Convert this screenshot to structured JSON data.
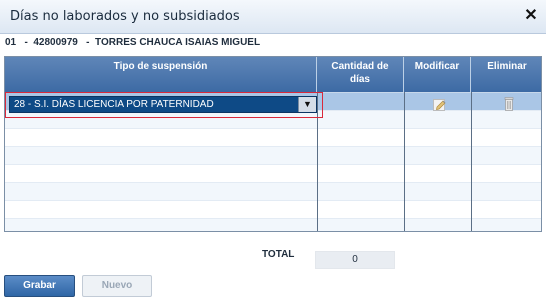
{
  "dialog": {
    "title": "Días no laborados y no subsidiados",
    "close_label": "✕"
  },
  "worker": {
    "line": "01   -  42800979   -  TORRES CHAUCA ISAIAS MIGUEL"
  },
  "table": {
    "headers": {
      "tipo": "Tipo de suspensión",
      "cantidad_line1": "Cantidad de",
      "cantidad_line2": "días",
      "modificar": "Modificar",
      "eliminar": "Eliminar"
    },
    "selected_row": {
      "tipo": "28 - S.I. DÍAS LICENCIA POR PATERNIDAD",
      "cantidad": ""
    }
  },
  "summary": {
    "total_label": "TOTAL",
    "total_value": "0"
  },
  "buttons": {
    "grabar": "Grabar",
    "nuevo": "Nuevo"
  },
  "icons": {
    "modify": "pencil-icon",
    "delete": "trash-icon",
    "dropdown": "chevron-down-icon"
  },
  "colors": {
    "header_blue": "#4f78ad",
    "selected_row": "#aac6e6",
    "select_bg": "#0e4a86",
    "error_border": "#d9293b"
  }
}
